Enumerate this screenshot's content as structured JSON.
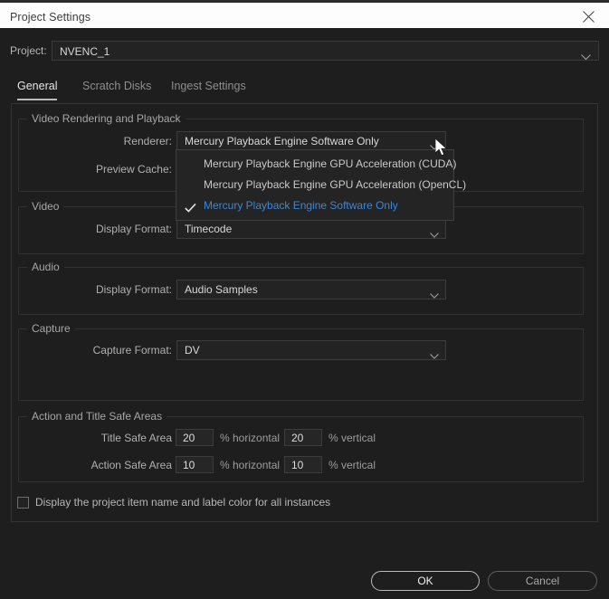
{
  "window": {
    "title": "Project Settings",
    "close_icon": "close-icon"
  },
  "project_row": {
    "label": "Project:",
    "value": "NVENC_1",
    "chevron_icon": "chevron-down-icon"
  },
  "tabs": [
    {
      "label": "General",
      "active": true
    },
    {
      "label": "Scratch Disks",
      "active": false
    },
    {
      "label": "Ingest Settings",
      "active": false
    }
  ],
  "groups": {
    "video_rendering": {
      "title": "Video Rendering and Playback",
      "renderer_label": "Renderer:",
      "renderer_value": "Mercury Playback Engine Software Only",
      "preview_cache_label": "Preview Cache:"
    },
    "video": {
      "title": "Video",
      "display_format_label": "Display Format:",
      "display_format_value": "Timecode"
    },
    "audio": {
      "title": "Audio",
      "display_format_label": "Display Format:",
      "display_format_value": "Audio Samples"
    },
    "capture": {
      "title": "Capture",
      "capture_format_label": "Capture Format:",
      "capture_format_value": "DV"
    },
    "safe_areas": {
      "title": "Action and Title Safe Areas",
      "title_safe_label": "Title Safe Area",
      "title_safe_horizontal": "20",
      "title_safe_horizontal_unit": "% horizontal",
      "title_safe_vertical": "20",
      "title_safe_vertical_unit": "% vertical",
      "action_safe_label": "Action Safe Area",
      "action_safe_horizontal": "10",
      "action_safe_horizontal_unit": "% horizontal",
      "action_safe_vertical": "10",
      "action_safe_vertical_unit": "% vertical"
    }
  },
  "checkbox": {
    "label": "Display the project item name and label color for all instances",
    "checked": false
  },
  "dropdown": {
    "open": true,
    "items": [
      {
        "label": "Mercury Playback Engine GPU Acceleration (CUDA)",
        "selected": false
      },
      {
        "label": "Mercury Playback Engine GPU Acceleration (OpenCL)",
        "selected": false
      },
      {
        "label": "Mercury Playback Engine Software Only",
        "selected": true
      }
    ],
    "check_icon": "check-icon"
  },
  "buttons": {
    "ok": "OK",
    "cancel": "Cancel"
  },
  "colors": {
    "background": "#1e1e1e",
    "titlebar": "#fdfdfd",
    "accent_selected": "#3d85d8",
    "field_background": "#232323",
    "border": "#3c3c3c"
  },
  "cursor": {
    "icon": "mouse-pointer-icon"
  }
}
